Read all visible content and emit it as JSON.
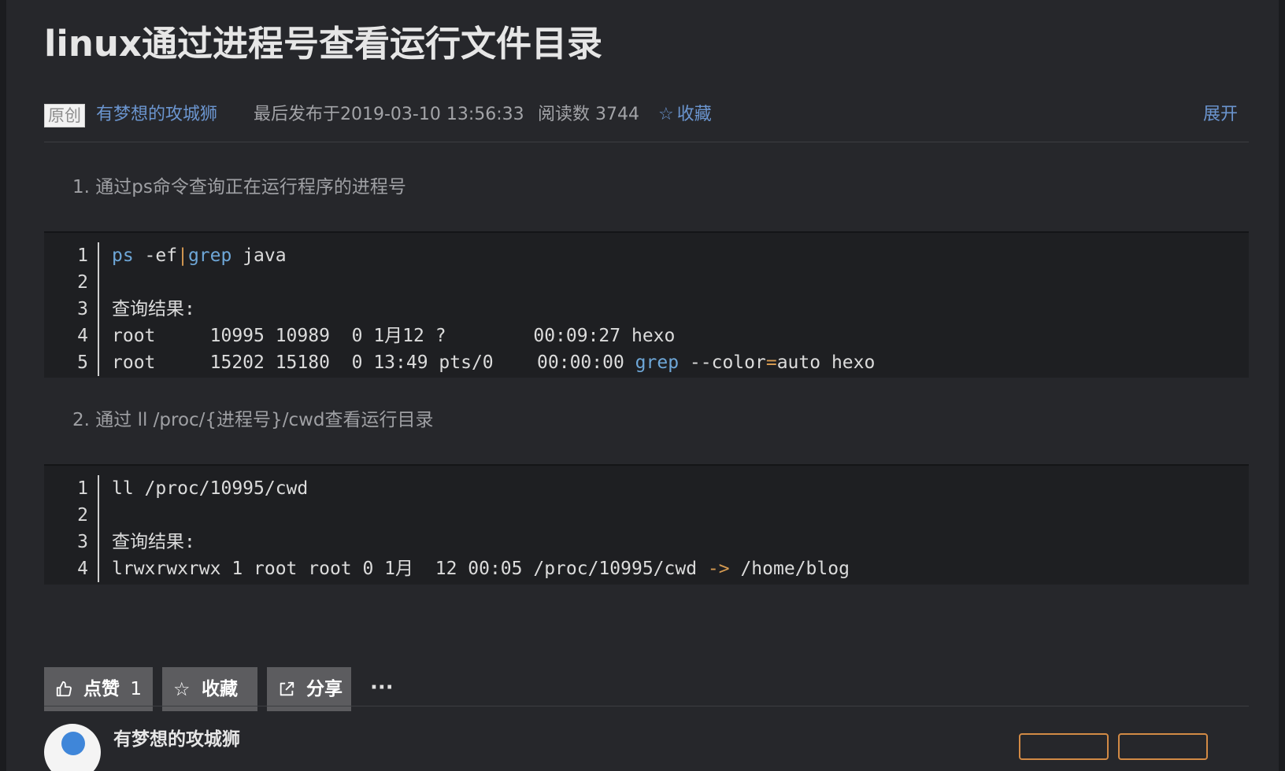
{
  "article": {
    "title": "linux通过进程号查看运行文件目录",
    "meta": {
      "badge": "原创",
      "author": "有梦想的攻城狮",
      "publish_time": "最后发布于2019-03-10 13:56:33",
      "read_count": "阅读数 3744",
      "collect_label": "收藏",
      "expand_label": "展开"
    },
    "steps": [
      "1. 通过ps命令查询正在运行程序的进程号",
      "2. 通过 ll /proc/{进程号}/cwd查看运行目录"
    ],
    "code_blocks": [
      {
        "line_numbers": [
          "1",
          "2",
          "3",
          "4",
          "5"
        ],
        "lines": [
          {
            "tokens": [
              {
                "text": "ps",
                "kind": "kw"
              },
              {
                "text": " -ef",
                "kind": "plain"
              },
              {
                "text": "|",
                "kind": "op"
              },
              {
                "text": "grep",
                "kind": "kw"
              },
              {
                "text": " java",
                "kind": "plain"
              }
            ]
          },
          {
            "tokens": [
              {
                "text": "",
                "kind": "plain"
              }
            ]
          },
          {
            "tokens": [
              {
                "text": "查询结果:",
                "kind": "plain"
              }
            ]
          },
          {
            "tokens": [
              {
                "text": "root     10995 10989  0 1月12 ?        00:09:27 hexo",
                "kind": "plain"
              }
            ]
          },
          {
            "tokens": [
              {
                "text": "root     15202 15180  0 13:49 pts/0    00:00:00 ",
                "kind": "plain"
              },
              {
                "text": "grep",
                "kind": "kw"
              },
              {
                "text": " --color",
                "kind": "plain"
              },
              {
                "text": "=",
                "kind": "op"
              },
              {
                "text": "auto hexo",
                "kind": "plain"
              }
            ]
          }
        ]
      },
      {
        "line_numbers": [
          "1",
          "2",
          "3",
          "4"
        ],
        "lines": [
          {
            "tokens": [
              {
                "text": "ll /proc/10995/cwd",
                "kind": "plain"
              }
            ]
          },
          {
            "tokens": [
              {
                "text": "",
                "kind": "plain"
              }
            ]
          },
          {
            "tokens": [
              {
                "text": "查询结果:",
                "kind": "plain"
              }
            ]
          },
          {
            "tokens": [
              {
                "text": "lrwxrwxrwx 1 root root 0 1月  12 00:05 /proc/10995/cwd ",
                "kind": "plain"
              },
              {
                "text": "->",
                "kind": "op"
              },
              {
                "text": " /home/blog",
                "kind": "plain"
              }
            ]
          }
        ]
      }
    ]
  },
  "actions": {
    "like_label": "点赞",
    "like_count": "1",
    "collect_label": "收藏",
    "share_label": "分享",
    "more_label": "···"
  },
  "footer": {
    "author_name": "有梦想的攻城狮"
  },
  "icons": {
    "star": "star-icon",
    "thumbs_up": "thumbs-up-icon",
    "share": "share-icon",
    "more": "more-icon"
  },
  "colors": {
    "background": "#26272b",
    "code_background": "#1e1f22",
    "link": "#6b95cf",
    "keyword": "#6ea7d8",
    "operator": "#d59a51",
    "button": "#5c5c5f",
    "follow_border": "#d28a45"
  }
}
